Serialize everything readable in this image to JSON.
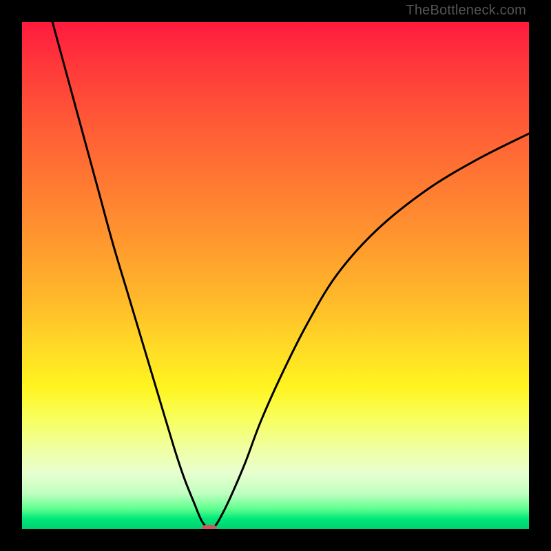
{
  "watermark": "TheBottleneck.com",
  "chart_data": {
    "type": "line",
    "title": "",
    "xlabel": "",
    "ylabel": "",
    "xlim": [
      0,
      100
    ],
    "ylim": [
      0,
      100
    ],
    "background_gradient": {
      "top": "#ff1a3e",
      "mid": "#ffda26",
      "bottom": "#00d070"
    },
    "series": [
      {
        "name": "bottleneck-curve",
        "color": "#000000",
        "x": [
          6,
          9,
          12,
          15,
          18,
          21,
          24,
          27,
          30,
          32,
          34,
          35.5,
          37,
          38,
          39,
          41,
          44,
          47,
          51,
          56,
          62,
          70,
          80,
          90,
          100
        ],
        "y": [
          100,
          89,
          78,
          67,
          56,
          46,
          36,
          26,
          16,
          10,
          5,
          1.5,
          0,
          0.5,
          2,
          6,
          13,
          21,
          30,
          40,
          50,
          59,
          67,
          73,
          78
        ]
      }
    ],
    "annotations": [
      {
        "name": "optimal-point",
        "x": 37,
        "y": 0,
        "color": "#c95b5b"
      }
    ],
    "legend": null,
    "grid": false
  },
  "plot": {
    "inner_w": 736,
    "inner_h": 736
  }
}
